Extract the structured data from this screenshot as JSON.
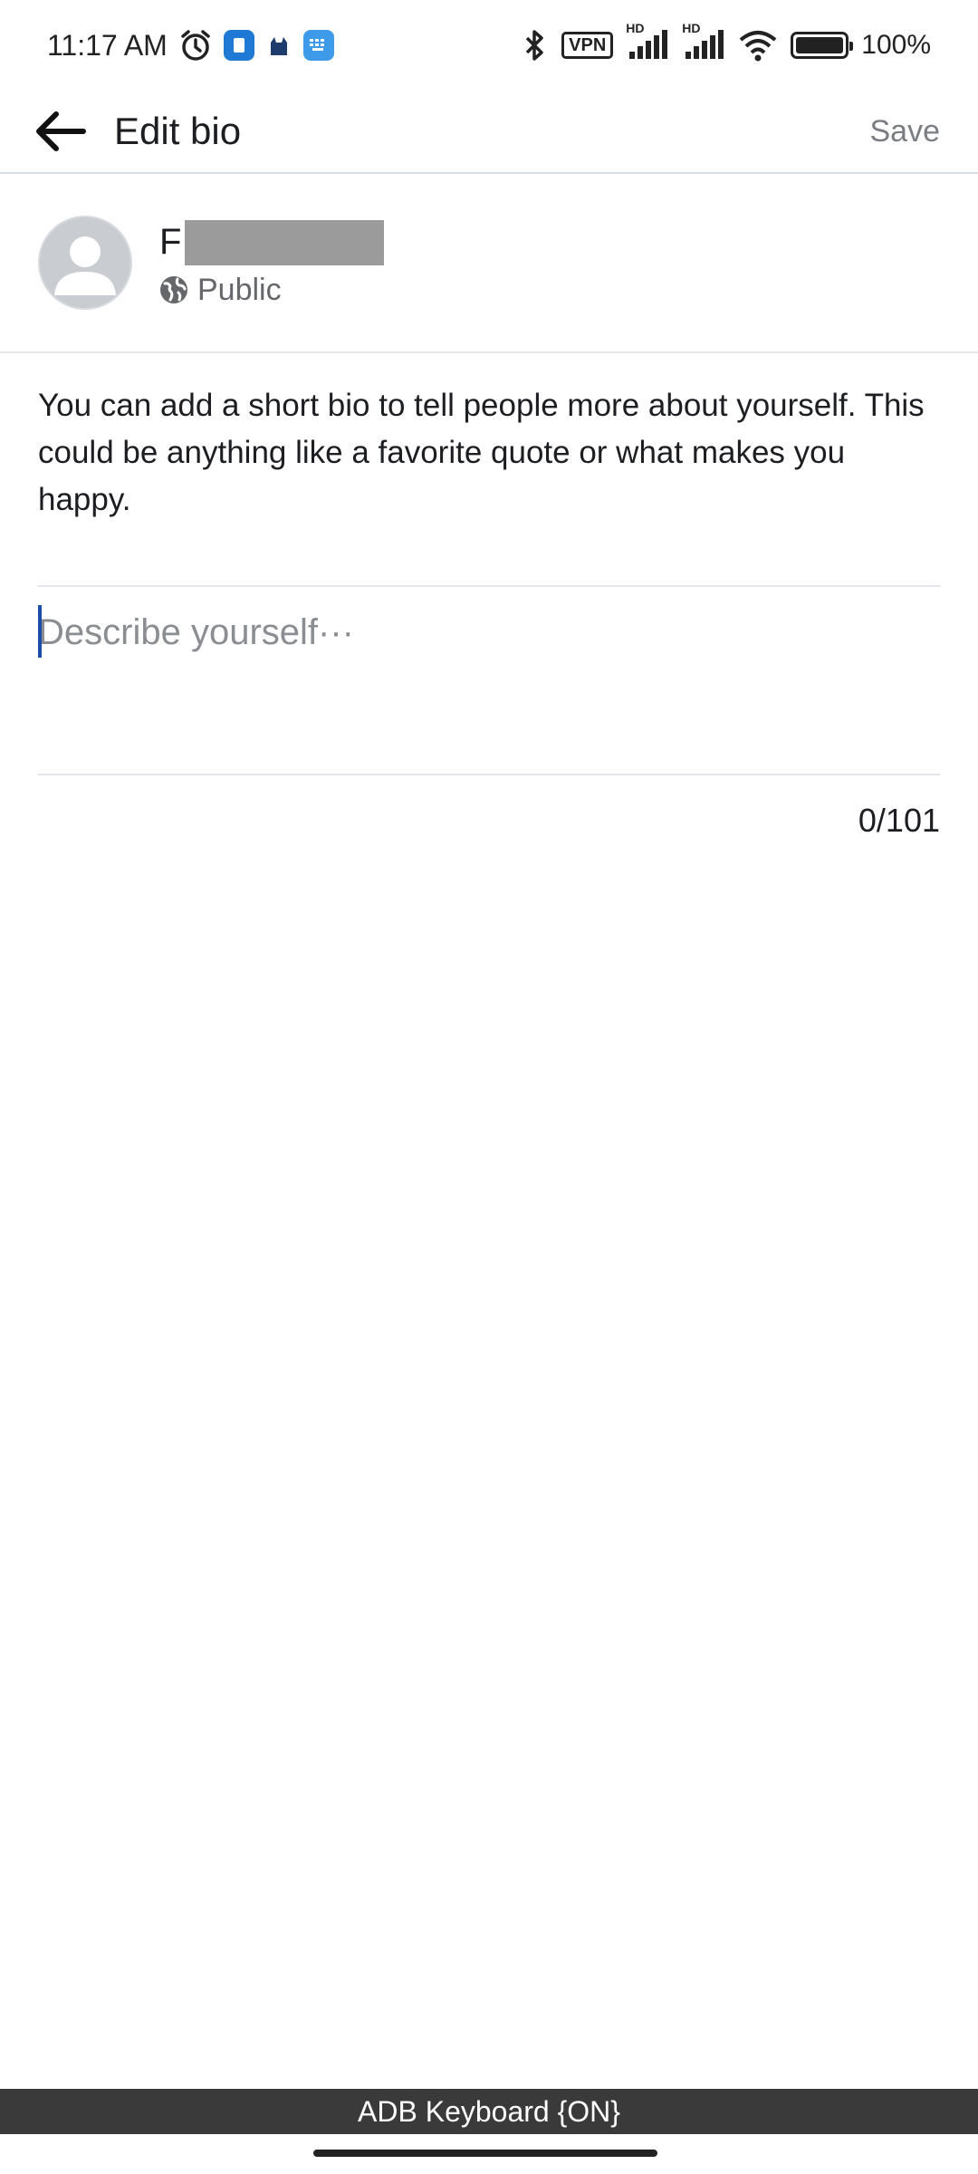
{
  "status_bar": {
    "time": "11:17 AM",
    "vpn": "VPN",
    "hd1": "HD",
    "hd2": "HD",
    "battery_text": "100%",
    "icons": [
      "alarm-icon",
      "app-badge-blue-icon",
      "cat-icon",
      "keyboard-app-icon",
      "bluetooth-icon",
      "vpn-icon",
      "signal-icon",
      "signal-icon",
      "wifi-icon",
      "battery-icon"
    ]
  },
  "header": {
    "title": "Edit bio",
    "save_label": "Save"
  },
  "profile": {
    "name_initial": "F",
    "privacy_label": "Public"
  },
  "description": "You can add a short bio to tell people more about yourself. This could be anything like a favorite quote or what makes you happy.",
  "bio_input": {
    "value": "",
    "placeholder": "Describe yourself···"
  },
  "char_count": "0/101",
  "keyboard_notice": "ADB Keyboard {ON}",
  "colors": {
    "caret": "#1b4ea8",
    "save_text": "#7a7d82",
    "keyboard_bar": "#3a3a3a"
  }
}
